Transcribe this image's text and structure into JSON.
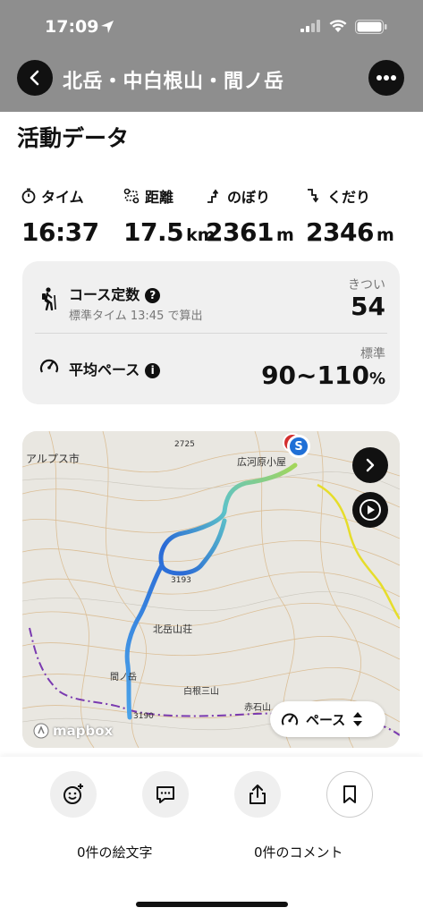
{
  "status": {
    "time": "17:09"
  },
  "header": {
    "title": "北岳・中白根山・間ノ岳"
  },
  "section": {
    "title": "活動データ"
  },
  "stats": [
    {
      "label": "タイム",
      "value": "16:37",
      "unit": "",
      "icon": "stopwatch-icon"
    },
    {
      "label": "距離",
      "value": "17.5",
      "unit": "km",
      "icon": "route-icon"
    },
    {
      "label": "のぼり",
      "value": "2361",
      "unit": "m",
      "icon": "ascent-icon"
    },
    {
      "label": "くだり",
      "value": "2346",
      "unit": "m",
      "icon": "descent-icon"
    }
  ],
  "course": {
    "label": "コース定数",
    "sub": "標準タイム 13:45 で算出",
    "caption": "きつい",
    "value": "54"
  },
  "pace": {
    "label": "平均ペース",
    "caption": "標準",
    "value": "90~110",
    "unit": "%"
  },
  "map": {
    "labels": [
      "アルプス市",
      "広河原小屋",
      "北岳山荘",
      "2725",
      "3193",
      "間ノ岳",
      "白根三山",
      "赤石山",
      "3190"
    ],
    "start_marker": "S",
    "pace_button": "ペース",
    "attribution": "mapbox"
  },
  "reactions": {
    "emoji_count": "0件の絵文字",
    "comment_count": "0件のコメント"
  },
  "colors": {
    "accent": "#1f6fd6",
    "header_bg": "#8e8e8e"
  }
}
